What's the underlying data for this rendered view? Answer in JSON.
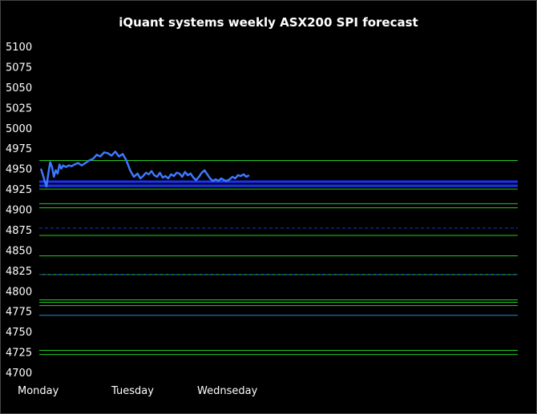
{
  "chart_data": {
    "type": "line",
    "title": "iQuant systems weekly ASX200 SPI forecast",
    "xlabel": "",
    "ylabel": "",
    "ylim": [
      4700,
      5100
    ],
    "yticks": [
      5100,
      5075,
      5050,
      5025,
      5000,
      4975,
      4950,
      4925,
      4900,
      4875,
      4850,
      4825,
      4800,
      4775,
      4750,
      4725,
      4700
    ],
    "x_labels": [
      "Monday",
      "Tuesday",
      "Wednseday"
    ],
    "grid": false,
    "levels": [
      {
        "value": 4960,
        "color": "#22cc22",
        "style": "solid"
      },
      {
        "value": 4934,
        "color": "#1a33ff",
        "style": "band"
      },
      {
        "value": 4929,
        "color": "#1a33ff",
        "style": "band"
      },
      {
        "value": 4925,
        "color": "#22cc22",
        "style": "solid"
      },
      {
        "value": 4907,
        "color": "#22cc22",
        "style": "solid"
      },
      {
        "value": 4902,
        "color": "#22cc22",
        "style": "solid"
      },
      {
        "value": 4877,
        "color": "#2233cc",
        "style": "dashed"
      },
      {
        "value": 4868,
        "color": "#22cc22",
        "style": "solid"
      },
      {
        "value": 4843,
        "color": "#22cc22",
        "style": "solid"
      },
      {
        "value": 4820,
        "color": "#22cc22",
        "style": "solid"
      },
      {
        "value": 4820,
        "color": "#2233cc",
        "style": "dashed"
      },
      {
        "value": 4789,
        "color": "#22cc22",
        "style": "solid"
      },
      {
        "value": 4786,
        "color": "#22cc22",
        "style": "solid"
      },
      {
        "value": 4782,
        "color": "#22cc22",
        "style": "solid"
      },
      {
        "value": 4770,
        "color": "#2288dd",
        "style": "solid"
      },
      {
        "value": 4727,
        "color": "#22cc22",
        "style": "solid"
      },
      {
        "value": 4722,
        "color": "#22cc22",
        "style": "solid"
      }
    ],
    "series": [
      {
        "color": "#3c78ff",
        "x": [
          0,
          0.02,
          0.04,
          0.06,
          0.08,
          0.1,
          0.12,
          0.14,
          0.16,
          0.18,
          0.2,
          0.22,
          0.24,
          0.27,
          0.3,
          0.33,
          0.36,
          0.4,
          0.44,
          0.48,
          0.52,
          0.56,
          0.6,
          0.64,
          0.68,
          0.72,
          0.76,
          0.8,
          0.84,
          0.88,
          0.92,
          0.96,
          1.0,
          1.04,
          1.07,
          1.1,
          1.13,
          1.16,
          1.19,
          1.22,
          1.25,
          1.28,
          1.31,
          1.34,
          1.37,
          1.4,
          1.43,
          1.46,
          1.49,
          1.52,
          1.55,
          1.58,
          1.61,
          1.64,
          1.67,
          1.7,
          1.73,
          1.76,
          1.79,
          1.82,
          1.85,
          1.88,
          1.91,
          1.94,
          1.97,
          2.0,
          2.03,
          2.06,
          2.09,
          2.12,
          2.15,
          2.18,
          2.21,
          2.24
        ],
        "values": [
          4950,
          4943,
          4935,
          4928,
          4944,
          4958,
          4952,
          4940,
          4948,
          4944,
          4955,
          4950,
          4954,
          4952,
          4954,
          4953,
          4955,
          4957,
          4954,
          4957,
          4960,
          4962,
          4967,
          4965,
          4970,
          4969,
          4966,
          4971,
          4965,
          4968,
          4960,
          4948,
          4940,
          4944,
          4938,
          4941,
          4945,
          4943,
          4947,
          4942,
          4940,
          4945,
          4939,
          4941,
          4938,
          4943,
          4941,
          4945,
          4944,
          4940,
          4946,
          4942,
          4944,
          4939,
          4936,
          4940,
          4945,
          4948,
          4943,
          4938,
          4935,
          4937,
          4935,
          4938,
          4936,
          4935,
          4937,
          4940,
          4938,
          4942,
          4941,
          4943,
          4940,
          4942
        ]
      }
    ]
  }
}
